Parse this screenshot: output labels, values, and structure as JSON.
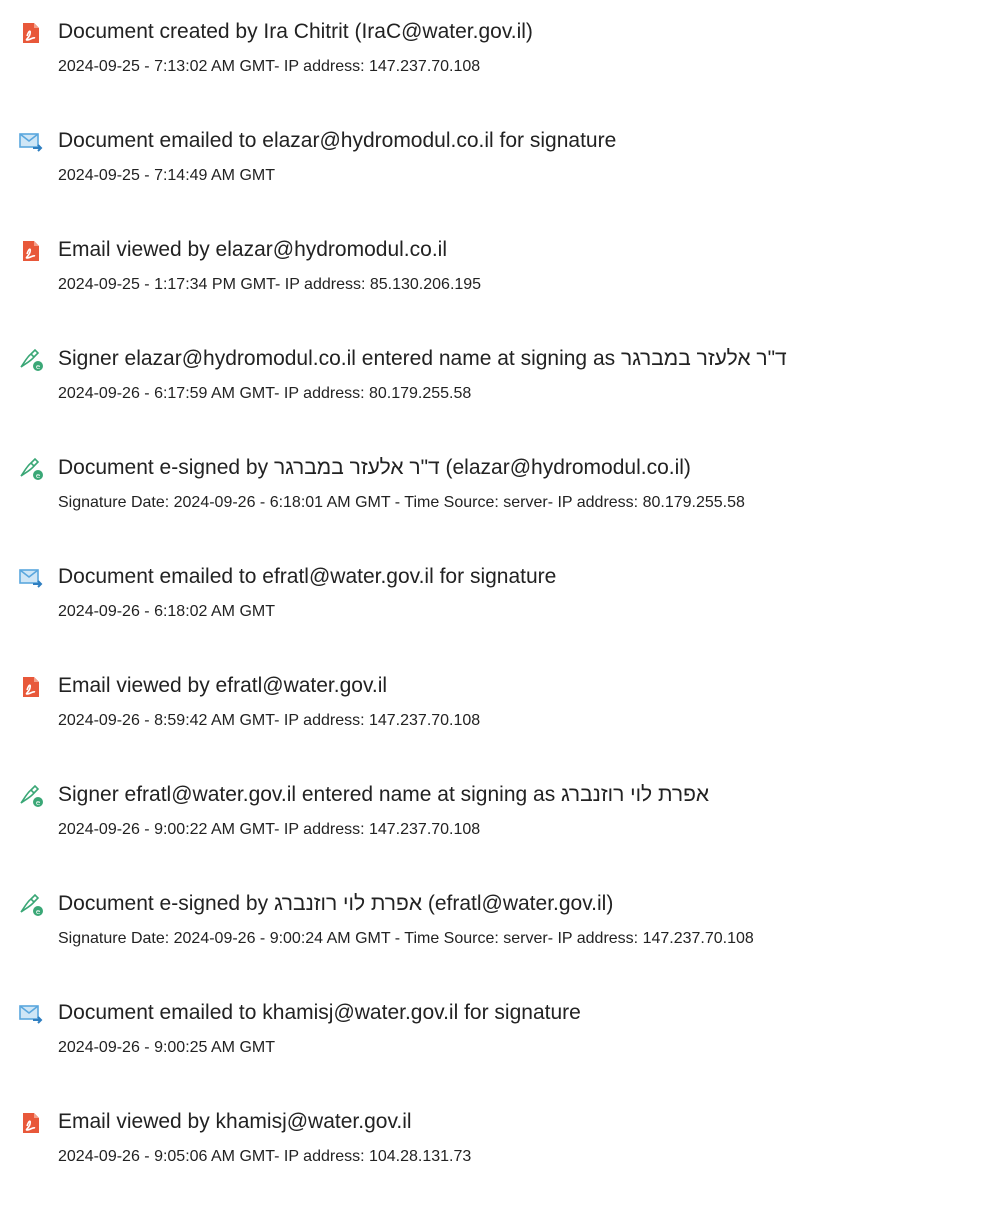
{
  "colors": {
    "acrobat_icon": "#e8583a",
    "email_icon": "#5aa7de",
    "esign_icon": "#3aa776",
    "text": "#222222"
  },
  "events": [
    {
      "icon": "acrobat-document-icon",
      "title": "Document created by Ira Chitrit (IraC@water.gov.il)",
      "meta": "2024-09-25 - 7:13:02 AM GMT- IP address: 147.237.70.108"
    },
    {
      "icon": "email-sent-icon",
      "title": "Document emailed to elazar@hydromodul.co.il for signature",
      "meta": "2024-09-25 - 7:14:49 AM GMT"
    },
    {
      "icon": "acrobat-document-icon",
      "title": "Email viewed by elazar@hydromodul.co.il",
      "meta": "2024-09-25 - 1:17:34 PM GMT- IP address: 85.130.206.195"
    },
    {
      "icon": "esign-pen-icon",
      "title_prefix": "Signer elazar@hydromodul.co.il entered name at signing as ",
      "title_name": "ד\"ר אלעזר במברגר",
      "meta": "2024-09-26 - 6:17:59 AM GMT- IP address: 80.179.255.58"
    },
    {
      "icon": "esign-pen-icon",
      "title_prefix": "Document e-signed by ",
      "title_name": "ד\"ר אלעזר במברגר",
      "title_suffix": " (elazar@hydromodul.co.il)",
      "meta": "Signature Date: 2024-09-26 - 6:18:01 AM GMT - Time Source: server- IP address: 80.179.255.58"
    },
    {
      "icon": "email-sent-icon",
      "title": "Document emailed to efratl@water.gov.il for signature",
      "meta": "2024-09-26 - 6:18:02 AM GMT"
    },
    {
      "icon": "acrobat-document-icon",
      "title": "Email viewed by efratl@water.gov.il",
      "meta": "2024-09-26 - 8:59:42 AM GMT- IP address: 147.237.70.108"
    },
    {
      "icon": "esign-pen-icon",
      "title_prefix": "Signer efratl@water.gov.il entered name at signing as ",
      "title_name": "אפרת לוי רוזנברג",
      "meta": "2024-09-26 - 9:00:22 AM GMT- IP address: 147.237.70.108"
    },
    {
      "icon": "esign-pen-icon",
      "title_prefix": "Document e-signed by ",
      "title_name": "אפרת לוי רוזנברג",
      "title_suffix": " (efratl@water.gov.il)",
      "meta": "Signature Date: 2024-09-26 - 9:00:24 AM GMT - Time Source: server- IP address: 147.237.70.108"
    },
    {
      "icon": "email-sent-icon",
      "title": "Document emailed to khamisj@water.gov.il for signature",
      "meta": "2024-09-26 - 9:00:25 AM GMT"
    },
    {
      "icon": "acrobat-document-icon",
      "title": "Email viewed by khamisj@water.gov.il",
      "meta": "2024-09-26 - 9:05:06 AM GMT- IP address: 104.28.131.73"
    }
  ]
}
